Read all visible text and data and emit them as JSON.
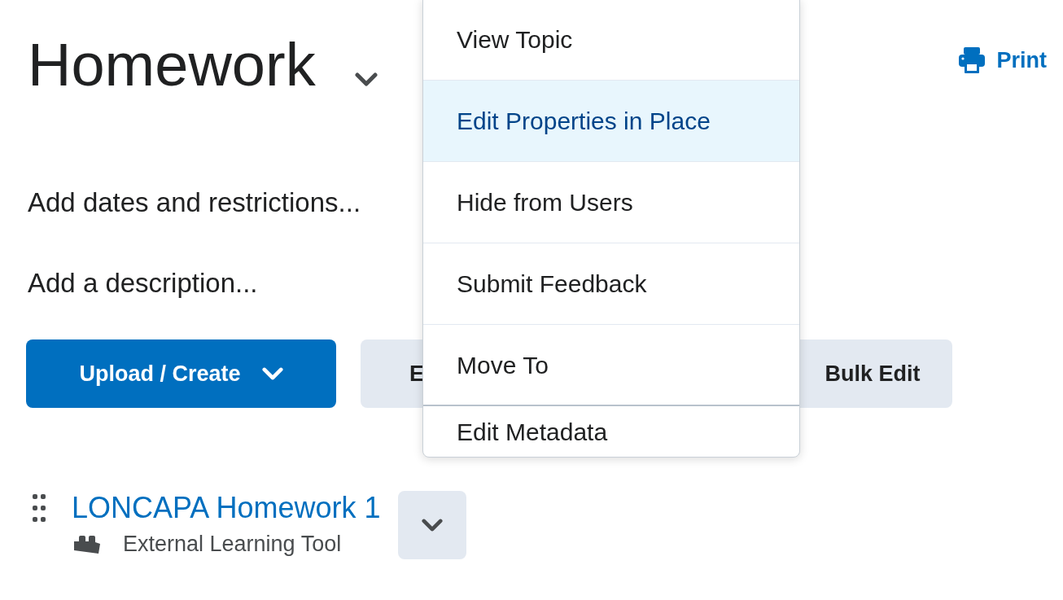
{
  "header": {
    "title": "Homework",
    "print": "Print"
  },
  "dates_link": "Add dates and restrictions...",
  "description_link": "Add a description...",
  "buttons": [
    {
      "label": "Upload / Create",
      "kind": "primary"
    },
    {
      "label": "E",
      "kind": "secondary"
    },
    {
      "label": "Bulk Edit",
      "kind": "secondary"
    }
  ],
  "topics": [
    {
      "title": "LONCAPA Homework 1",
      "type": "External Learning Tool"
    }
  ],
  "menu": {
    "items": [
      {
        "label": "View Topic",
        "selected": false
      },
      {
        "label": "Edit Properties in Place",
        "selected": true
      },
      {
        "label": "Hide from Users",
        "selected": false
      },
      {
        "label": "Submit Feedback",
        "selected": false
      },
      {
        "label": "Move To",
        "selected": false
      },
      {
        "label": "Edit Metadata",
        "selected": false
      }
    ]
  }
}
